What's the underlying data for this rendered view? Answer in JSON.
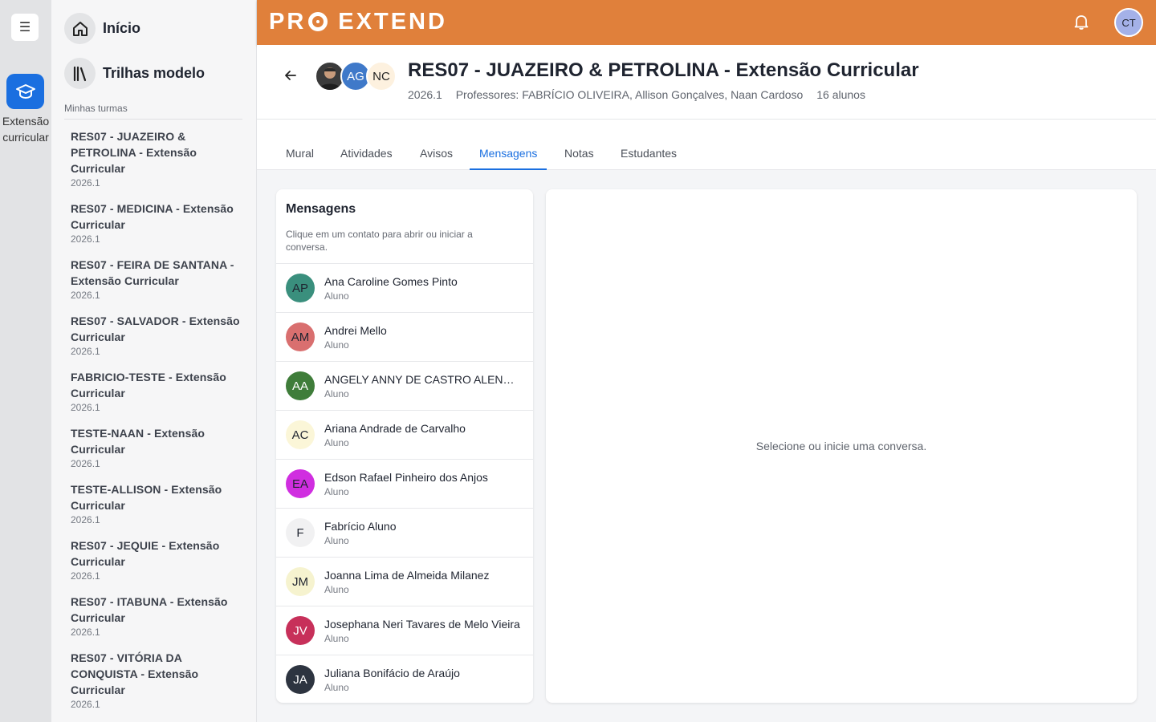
{
  "rail": {
    "menu_icon": "hamburger-icon",
    "app_icon": "graduation-cap-icon",
    "app_label": "Extensão curricular",
    "accent": "#1a6fe0"
  },
  "sidebar": {
    "nav": [
      {
        "label": "Início",
        "icon": "home-icon"
      },
      {
        "label": "Trilhas modelo",
        "icon": "library-icon"
      }
    ],
    "section_title": "Minhas turmas",
    "classes": [
      {
        "name": "RES07 - JUAZEIRO & PETROLINA - Extensão Curricular",
        "term": "2026.1"
      },
      {
        "name": "RES07 - MEDICINA - Extensão Curricular",
        "term": "2026.1"
      },
      {
        "name": "RES07 - FEIRA DE SANTANA - Extensão Curricular",
        "term": "2026.1"
      },
      {
        "name": "RES07 - SALVADOR - Extensão Curricular",
        "term": "2026.1"
      },
      {
        "name": "FABRICIO-TESTE - Extensão Curricular",
        "term": "2026.1"
      },
      {
        "name": "TESTE-NAAN - Extensão Curricular",
        "term": "2026.1"
      },
      {
        "name": "TESTE-ALLISON - Extensão Curricular",
        "term": "2026.1"
      },
      {
        "name": "RES07 - JEQUIE - Extensão Curricular",
        "term": "2026.1"
      },
      {
        "name": "RES07 - ITABUNA - Extensão Curricular",
        "term": "2026.1"
      },
      {
        "name": "RES07 - VITÓRIA DA CONQUISTA - Extensão Curricular",
        "term": "2026.1"
      }
    ]
  },
  "header": {
    "logo_left": "PR",
    "logo_right": "EXTEND",
    "brand_color": "#e0803b",
    "bell_icon": "bell-icon",
    "user_initials": "CT"
  },
  "course": {
    "title": "RES07 - JUAZEIRO & PETROLINA - Extensão Curricular",
    "term": "2026.1",
    "professors": "Professores: FABRÍCIO OLIVEIRA, Allison Gonçalves, Naan Cardoso",
    "students_count": "16 alunos",
    "avatars": [
      {
        "initials": "AG"
      },
      {
        "initials": "NC"
      }
    ]
  },
  "tabs": [
    {
      "label": "Mural"
    },
    {
      "label": "Atividades"
    },
    {
      "label": "Avisos"
    },
    {
      "label": "Mensagens",
      "active": true
    },
    {
      "label": "Notas"
    },
    {
      "label": "Estudantes"
    }
  ],
  "messages": {
    "title": "Mensagens",
    "hint": "Clique em um contato para abrir ou iniciar a conversa.",
    "contacts": [
      {
        "initials": "AP",
        "name": "Ana Caroline Gomes Pinto",
        "role": "Aluno",
        "color": "#3a8f7d",
        "text_color": "#1f2430"
      },
      {
        "initials": "AM",
        "name": "Andrei Mello",
        "role": "Aluno",
        "color": "#d96f6f",
        "text_color": "#1f2430"
      },
      {
        "initials": "AA",
        "name": "ANGELY ANNY DE CASTRO ALENCAR",
        "role": "Aluno",
        "color": "#3f7d3a",
        "text_color": "#ffffff"
      },
      {
        "initials": "AC",
        "name": "Ariana Andrade de Carvalho",
        "role": "Aluno",
        "color": "#fbf6d8",
        "text_color": "#1f2430"
      },
      {
        "initials": "EA",
        "name": "Edson Rafael Pinheiro dos Anjos",
        "role": "Aluno",
        "color": "#d02ee0",
        "text_color": "#1f2430"
      },
      {
        "initials": "F",
        "name": "Fabrício Aluno",
        "role": "Aluno",
        "color": "#f1f1f2",
        "text_color": "#1f2430"
      },
      {
        "initials": "JM",
        "name": "Joanna Lima de Almeida Milanez",
        "role": "Aluno",
        "color": "#f6f3cf",
        "text_color": "#1f2430"
      },
      {
        "initials": "JV",
        "name": "Josephana Neri Tavares de Melo Vieira",
        "role": "Aluno",
        "color": "#c7305a",
        "text_color": "#ffffff"
      },
      {
        "initials": "JA",
        "name": "Juliana Bonifácio de Araújo",
        "role": "Aluno",
        "color": "#2d3440",
        "text_color": "#ffffff"
      }
    ],
    "empty_state": "Selecione ou inicie uma conversa."
  }
}
